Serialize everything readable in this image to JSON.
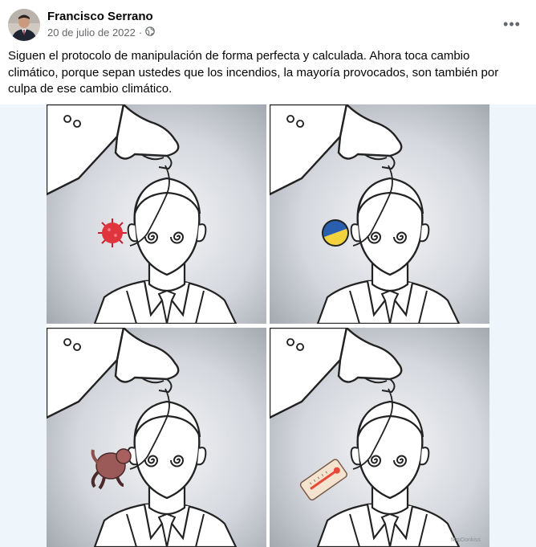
{
  "post": {
    "author": "Francisco Serrano",
    "date": "20 de julio de 2022",
    "separator": "·",
    "audience_icon": "globe-icon",
    "more_icon": "more-options-icon",
    "more_label": "•••",
    "caption": "Siguen el protocolo de manipulación de forma perfecta y calculada. Ahora toca cambio climático, porque sepan ustedes que los incendios, la mayoría provocados, son también por culpa de ese cambio climático.",
    "avatar_icon": "profile-photo"
  },
  "comic": {
    "panels": [
      {
        "object_icon": "virus-icon",
        "object_color": "#d92a36"
      },
      {
        "object_icon": "blue-yellow-badge-icon",
        "object_color": "#2a5fb0"
      },
      {
        "object_icon": "monkey-icon",
        "object_color": "#9b5a58"
      },
      {
        "object_icon": "thermometer-icon",
        "object_color": "#e84a3a"
      }
    ],
    "signature": "MrpDonkiss"
  },
  "colors": {
    "panel_bg": "#d3d6dc",
    "panel_light": "#f2f3f5",
    "image_backdrop": "#eef5fb",
    "text_secondary": "#65676b"
  }
}
